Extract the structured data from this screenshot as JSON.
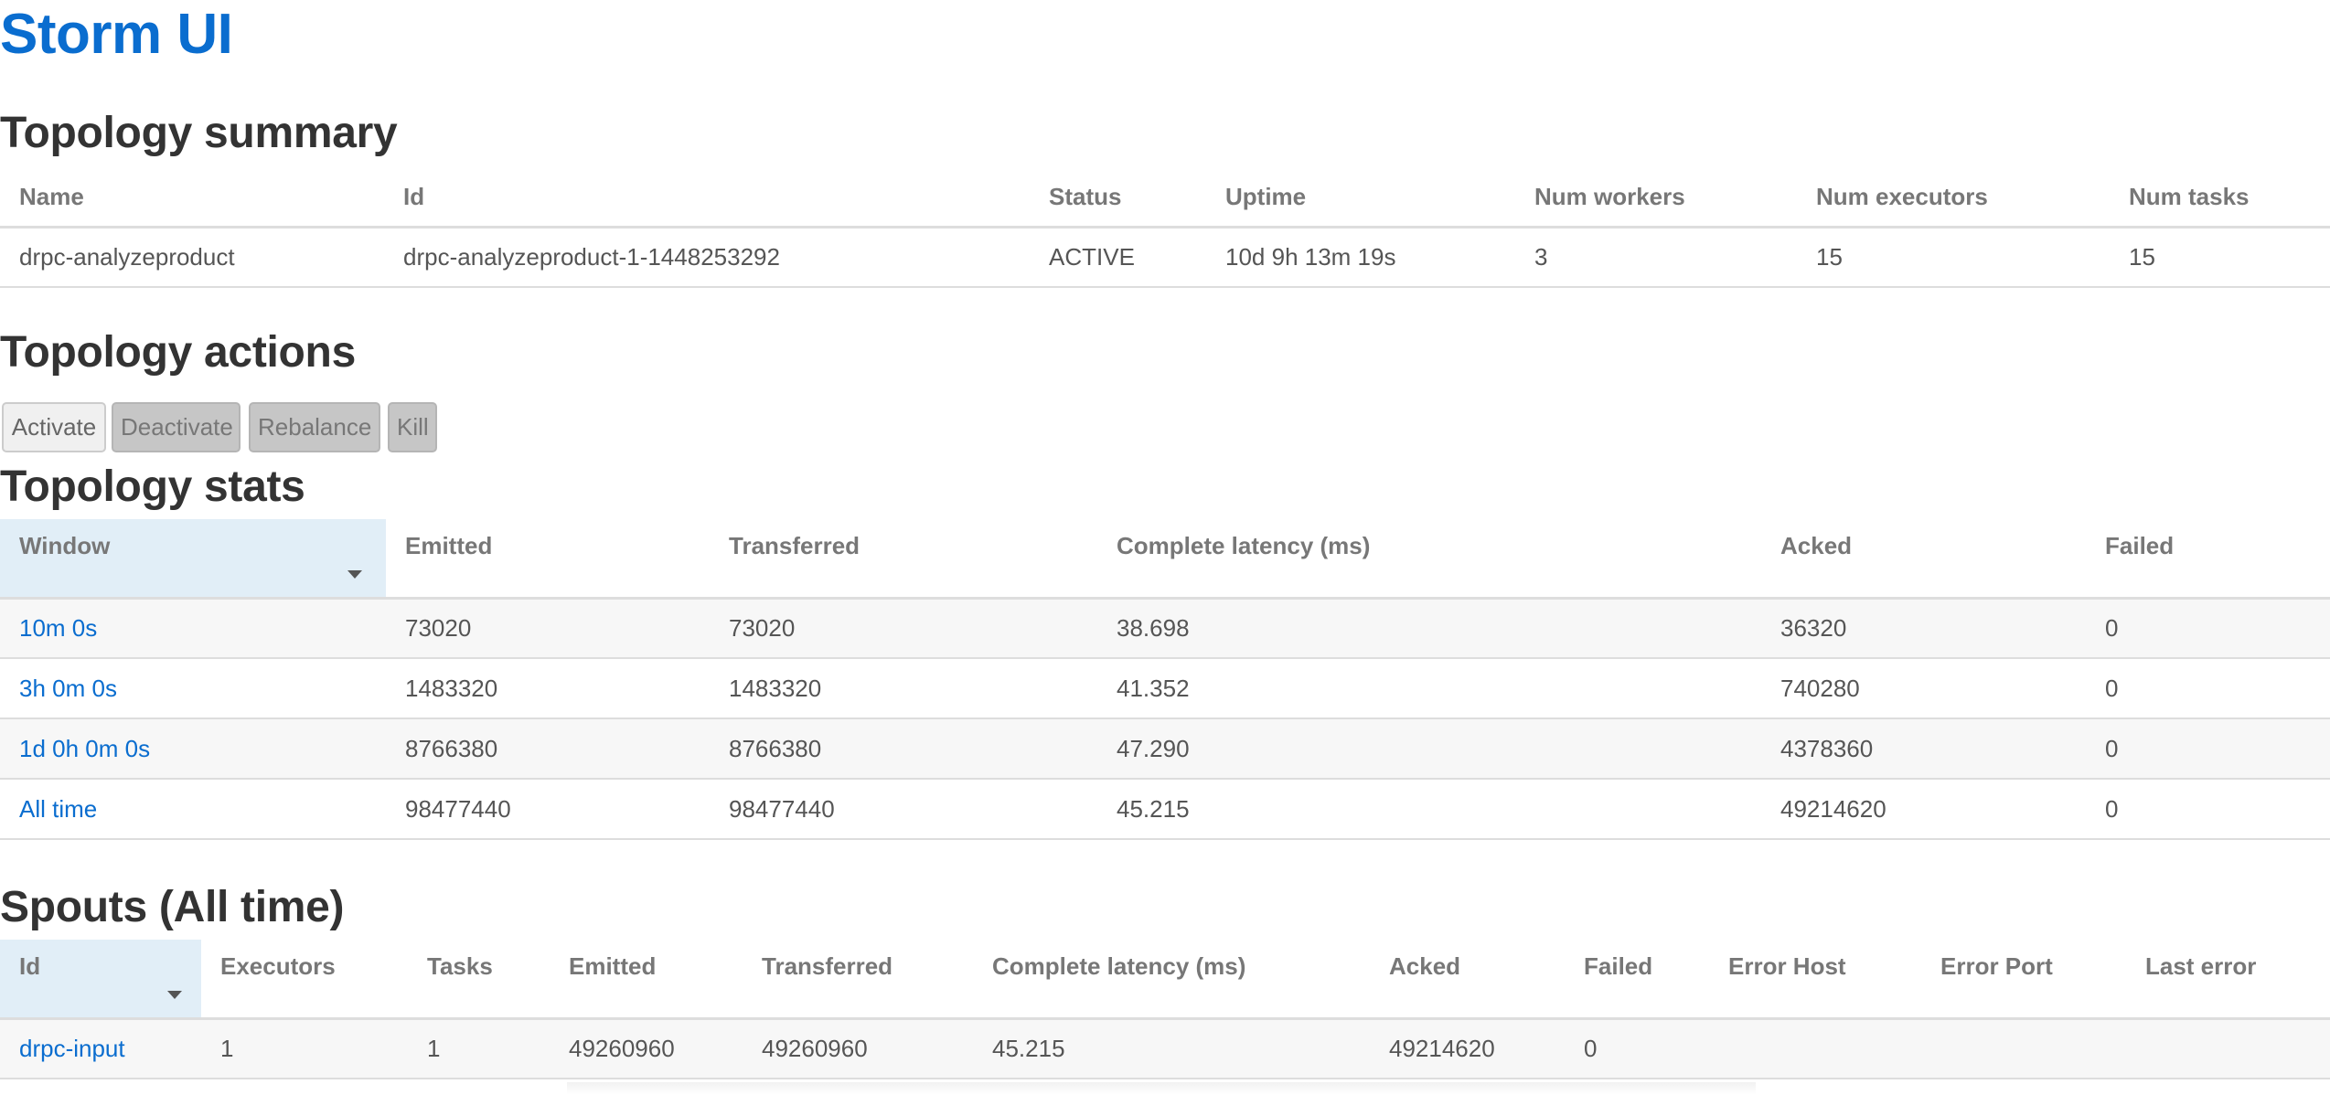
{
  "app": {
    "title": "Storm UI"
  },
  "topology_summary": {
    "title": "Topology summary",
    "headers": {
      "name": "Name",
      "id": "Id",
      "status": "Status",
      "uptime": "Uptime",
      "num_workers": "Num workers",
      "num_executors": "Num executors",
      "num_tasks": "Num tasks"
    },
    "row": {
      "name": "drpc-analyzeproduct",
      "id": "drpc-analyzeproduct-1-1448253292",
      "status": "ACTIVE",
      "uptime": "10d 9h 13m 19s",
      "num_workers": "3",
      "num_executors": "15",
      "num_tasks": "15"
    }
  },
  "topology_actions": {
    "title": "Topology actions",
    "buttons": {
      "activate": "Activate",
      "deactivate": "Deactivate",
      "rebalance": "Rebalance",
      "kill": "Kill"
    }
  },
  "topology_stats": {
    "title": "Topology stats",
    "headers": {
      "window": "Window",
      "emitted": "Emitted",
      "transferred": "Transferred",
      "complete_latency": "Complete latency (ms)",
      "acked": "Acked",
      "failed": "Failed"
    },
    "rows": [
      {
        "window": "10m 0s",
        "emitted": "73020",
        "transferred": "73020",
        "complete_latency": "38.698",
        "acked": "36320",
        "failed": "0"
      },
      {
        "window": "3h 0m 0s",
        "emitted": "1483320",
        "transferred": "1483320",
        "complete_latency": "41.352",
        "acked": "740280",
        "failed": "0"
      },
      {
        "window": "1d 0h 0m 0s",
        "emitted": "8766380",
        "transferred": "8766380",
        "complete_latency": "47.290",
        "acked": "4378360",
        "failed": "0"
      },
      {
        "window": "All time",
        "emitted": "98477440",
        "transferred": "98477440",
        "complete_latency": "45.215",
        "acked": "49214620",
        "failed": "0"
      }
    ]
  },
  "spouts": {
    "title": "Spouts (All time)",
    "headers": {
      "id": "Id",
      "executors": "Executors",
      "tasks": "Tasks",
      "emitted": "Emitted",
      "transferred": "Transferred",
      "complete_latency": "Complete latency (ms)",
      "acked": "Acked",
      "failed": "Failed",
      "error_host": "Error Host",
      "error_port": "Error Port",
      "last_error": "Last error"
    },
    "rows": [
      {
        "id": "drpc-input",
        "executors": "1",
        "tasks": "1",
        "emitted": "49260960",
        "transferred": "49260960",
        "complete_latency": "45.215",
        "acked": "49214620",
        "failed": "0",
        "error_host": "",
        "error_port": "",
        "last_error": ""
      }
    ]
  },
  "colors": {
    "brand": "#0a6dcf",
    "heading": "#333333",
    "sorted_header_bg": "#e1eef7",
    "button_disabled_bg": "#c6c6c6",
    "row_stripe": "#f7f7f7"
  },
  "icons": {
    "sort": "caret-down-icon"
  }
}
